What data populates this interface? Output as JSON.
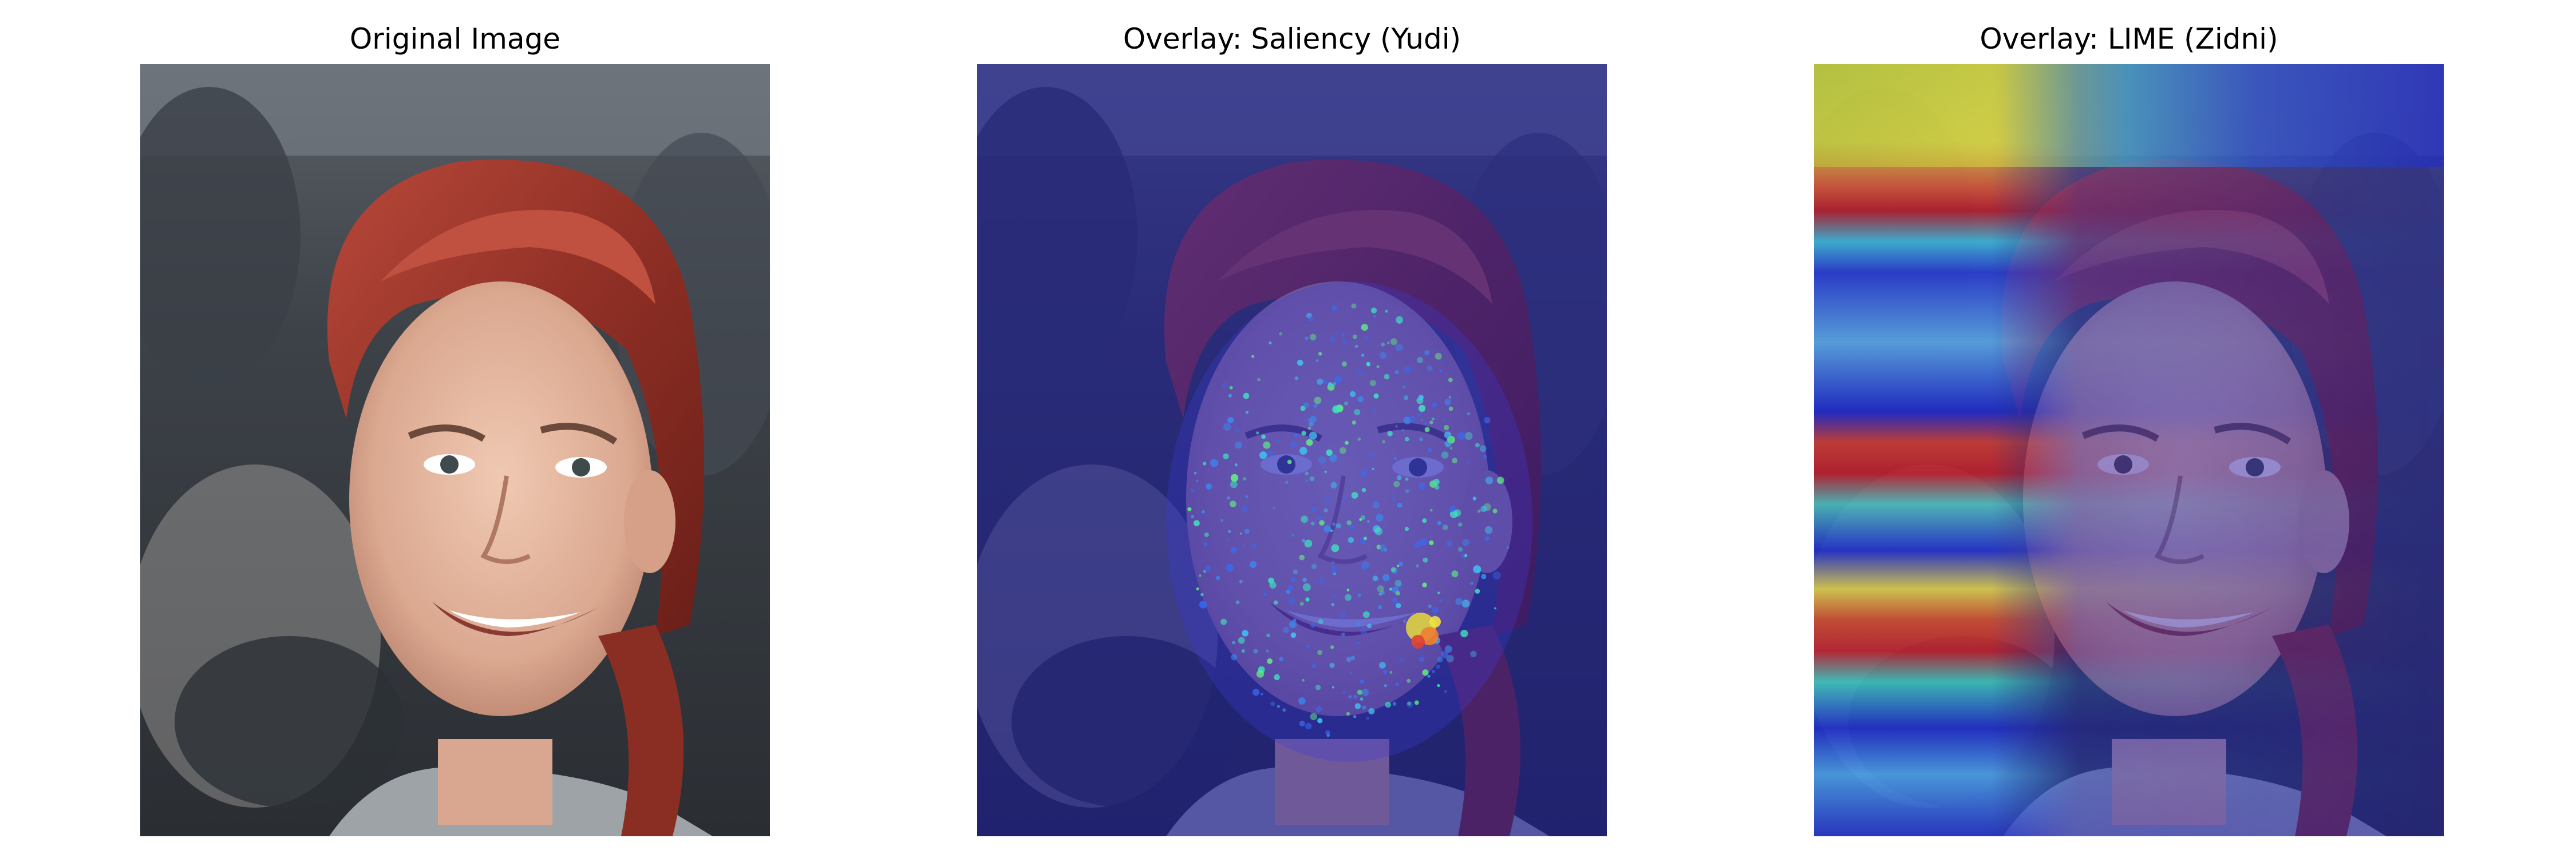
{
  "panels": [
    {
      "title": "Original Image",
      "overlay": "none"
    },
    {
      "title": "Overlay: Saliency (Yudi)",
      "overlay": "saliency",
      "colormap": "jet"
    },
    {
      "title": "Overlay: LIME (Zidni)",
      "overlay": "lime",
      "colormap": "jet"
    }
  ],
  "colors": {
    "hair": "#9a3327",
    "skin": "#e6b9a2",
    "background_dark": "#3a3f46",
    "overlay_blue": "#1c1ca8"
  }
}
